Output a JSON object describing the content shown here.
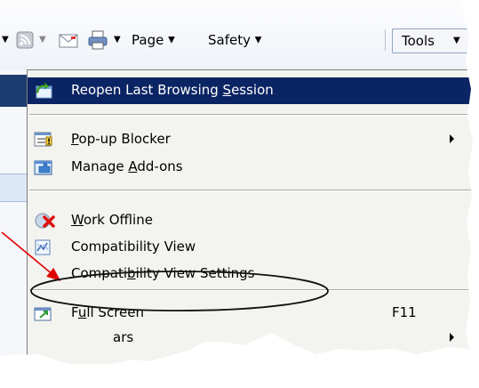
{
  "toolbar": {
    "page_label": "Page",
    "safety_label": "Safety",
    "tools_label": "Tools",
    "dropdown_arrow": "▼"
  },
  "menu": {
    "items": [
      {
        "label_pre": "Reopen Last Browsing ",
        "label_u": "S",
        "label_post": "ession",
        "icon": "reopen-session-icon",
        "highlighted": true
      },
      {
        "label_pre": "",
        "label_u": "P",
        "label_post": "op-up Blocker",
        "icon": "popup-blocker-icon",
        "submenu": true
      },
      {
        "label_pre": "Manage ",
        "label_u": "A",
        "label_post": "dd-ons",
        "icon": "addons-icon"
      },
      {
        "label_pre": "",
        "label_u": "W",
        "label_post": "ork Offline",
        "icon": "work-offline-icon"
      },
      {
        "label_pre": "Compatibility View",
        "label_u": "",
        "label_post": "",
        "icon": "compatibility-view-icon"
      },
      {
        "label_pre": "Compati",
        "label_u": "b",
        "label_post": "ility View Settings",
        "icon": ""
      },
      {
        "label_pre": "F",
        "label_u": "u",
        "label_post": "ll Screen",
        "shortcut": "F11",
        "icon": "full-screen-icon"
      },
      {
        "label_pre": "",
        "label_u": "",
        "label_post": "ars",
        "icon": "",
        "submenu": true
      }
    ]
  },
  "colors": {
    "menu_bg": "#f3f3ef",
    "highlight_bg": "#0b2463",
    "annotation_arrow": "#e00000"
  }
}
